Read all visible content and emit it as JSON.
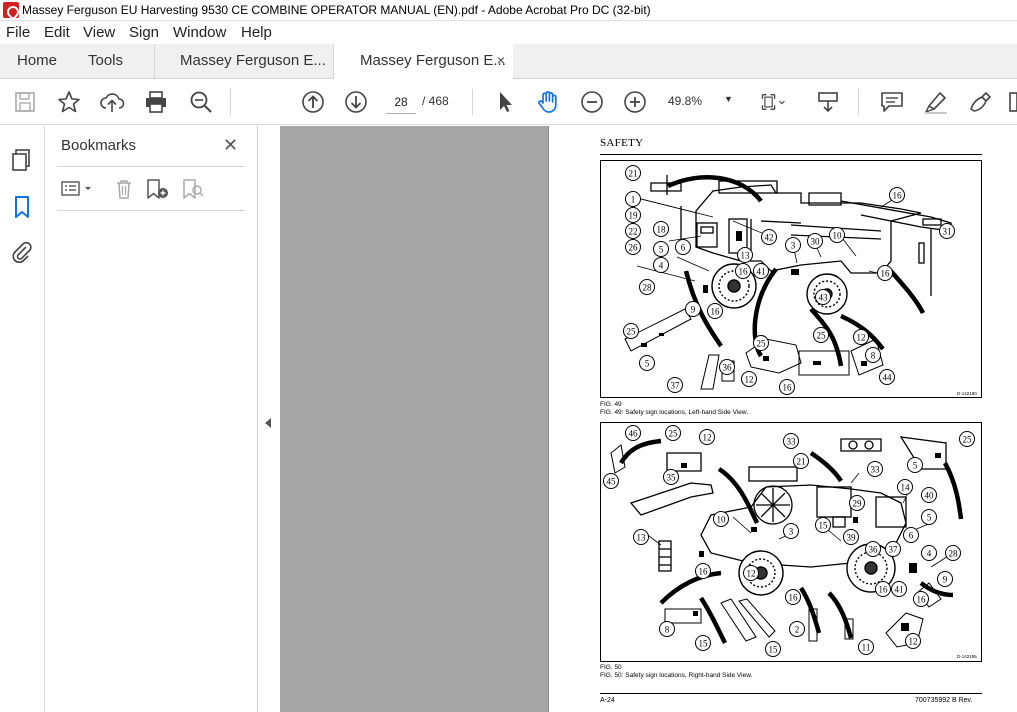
{
  "window": {
    "title": "Massey Ferguson EU Harvesting 9530 CE COMBINE OPERATOR MANUAL (EN).pdf - Adobe Acrobat Pro DC (32-bit)"
  },
  "menu": [
    "File",
    "Edit",
    "View",
    "Sign",
    "Window",
    "Help"
  ],
  "tabs": {
    "home": "Home",
    "tools": "Tools",
    "doc1": "Massey Ferguson E...",
    "doc2": "Massey Ferguson E...",
    "close": "×"
  },
  "toolbar": {
    "page_current": "28",
    "page_total": "/ 468",
    "zoom": "49.8%"
  },
  "bookmarks": {
    "title": "Bookmarks",
    "close": "✕"
  },
  "document": {
    "section": "SAFETY",
    "fig49_label": "FIG. 49",
    "fig49_caption": "FIG. 49:  Safety sign locations, Left-hand Side View.",
    "fig49_code": "D-142180",
    "fig50_label": "FIG. 50",
    "fig50_caption": "FIG. 50:  Safety sign locations, Right-hand Side View.",
    "fig50_code": "D-142195",
    "footer_left": "A-24",
    "footer_right": "700735992 B Rev."
  },
  "fig49_callouts": [
    "21",
    "16",
    "1",
    "19",
    "22",
    "26",
    "18",
    "5",
    "6",
    "4",
    "28",
    "42",
    "13",
    "3",
    "30",
    "10",
    "31",
    "16",
    "41",
    "43",
    "16",
    "9",
    "16",
    "25",
    "25",
    "12",
    "5",
    "25",
    "8",
    "37",
    "36",
    "12",
    "16",
    "44"
  ],
  "fig50_callouts": [
    "46",
    "25",
    "12",
    "33",
    "25",
    "45",
    "35",
    "21",
    "5",
    "33",
    "14",
    "40",
    "29",
    "10",
    "15",
    "5",
    "13",
    "3",
    "39",
    "36",
    "37",
    "6",
    "4",
    "28",
    "16",
    "12",
    "16",
    "16",
    "41",
    "9",
    "16",
    "8",
    "2",
    "15",
    "15",
    "11",
    "12"
  ],
  "colors": {
    "accent": "#1473e6",
    "viewport_bg": "#a5a5a5",
    "red": "#d32020"
  }
}
